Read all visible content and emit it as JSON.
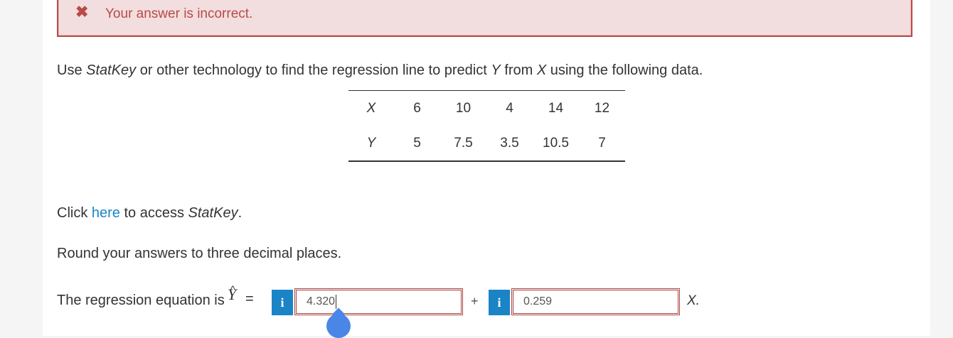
{
  "alert": {
    "icon": "x-mark-icon",
    "icon_glyph": "✖",
    "message": "Your answer is incorrect.",
    "color": "#b94a48",
    "background": "#f2dede"
  },
  "question": {
    "part1": "Use ",
    "statkey": "StatKey",
    "part2": " or other technology to find the regression line to predict ",
    "y": "Y",
    "part3": " from ",
    "x": "X",
    "part4": " using the following data."
  },
  "data_table": {
    "x_label": "X",
    "y_label": "Y",
    "x_values": [
      "6",
      "10",
      "4",
      "14",
      "12"
    ],
    "y_values": [
      "5",
      "7.5",
      "3.5",
      "10.5",
      "7"
    ]
  },
  "click_line": {
    "prefix": "Click ",
    "link": "here",
    "middle": " to access ",
    "statkey": "StatKey",
    "suffix": "."
  },
  "round_instruction": "Round your answers to three decimal places.",
  "equation": {
    "label": "The regression equation is ",
    "yhat_symbol": "Y",
    "hat_glyph": "^",
    "equals": "=",
    "info_glyph": "i",
    "intercept_value": "4.320",
    "plus": "+",
    "slope_value": "0.259",
    "trailing_var": "X."
  },
  "colors": {
    "link": "#1a84c6",
    "info_button": "#1a84c6",
    "error_border": "#a94442",
    "drag_handle": "#4a86e8"
  }
}
